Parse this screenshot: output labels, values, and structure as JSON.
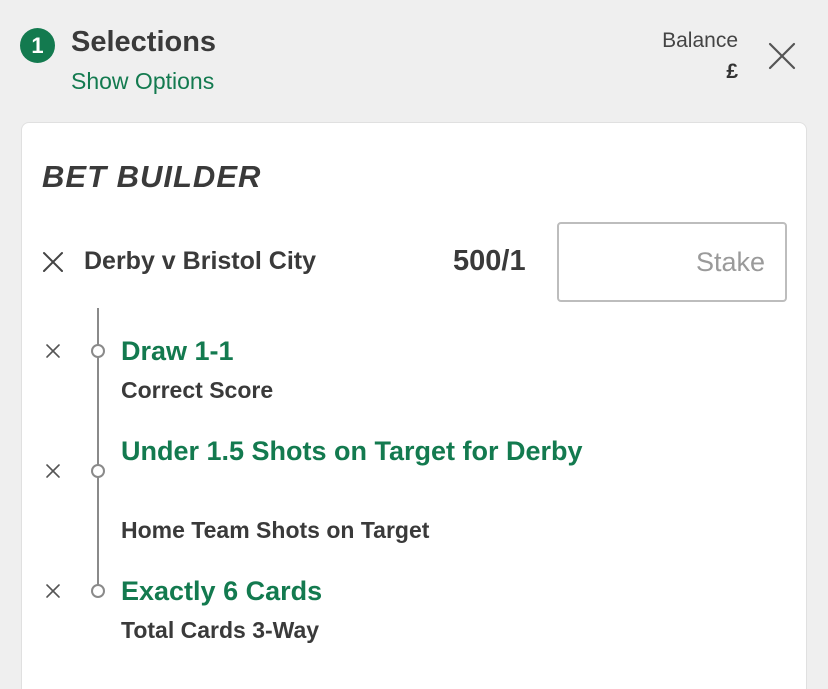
{
  "header": {
    "selection_count": "1",
    "title": "Selections",
    "show_options": "Show Options",
    "balance_label": "Balance",
    "balance_value": "£"
  },
  "bet_builder": {
    "title": "BET BUILDER",
    "event_name": "Derby v Bristol City",
    "odds": "500/1",
    "stake_placeholder": "Stake",
    "stake_value": "",
    "legs": [
      {
        "title": "Draw 1-1",
        "market": "Correct Score"
      },
      {
        "title": "Under 1.5 Shots on Target for Derby",
        "market": "Home Team Shots on Target"
      },
      {
        "title": "Exactly 6 Cards",
        "market": "Total Cards 3-Way"
      }
    ]
  },
  "colors": {
    "accent": "#137a4f",
    "background": "#efefef",
    "card": "#ffffff",
    "text": "#3a3a3a"
  },
  "icons": {
    "close": "close-icon",
    "remove": "remove-icon",
    "node": "timeline-node-icon"
  }
}
